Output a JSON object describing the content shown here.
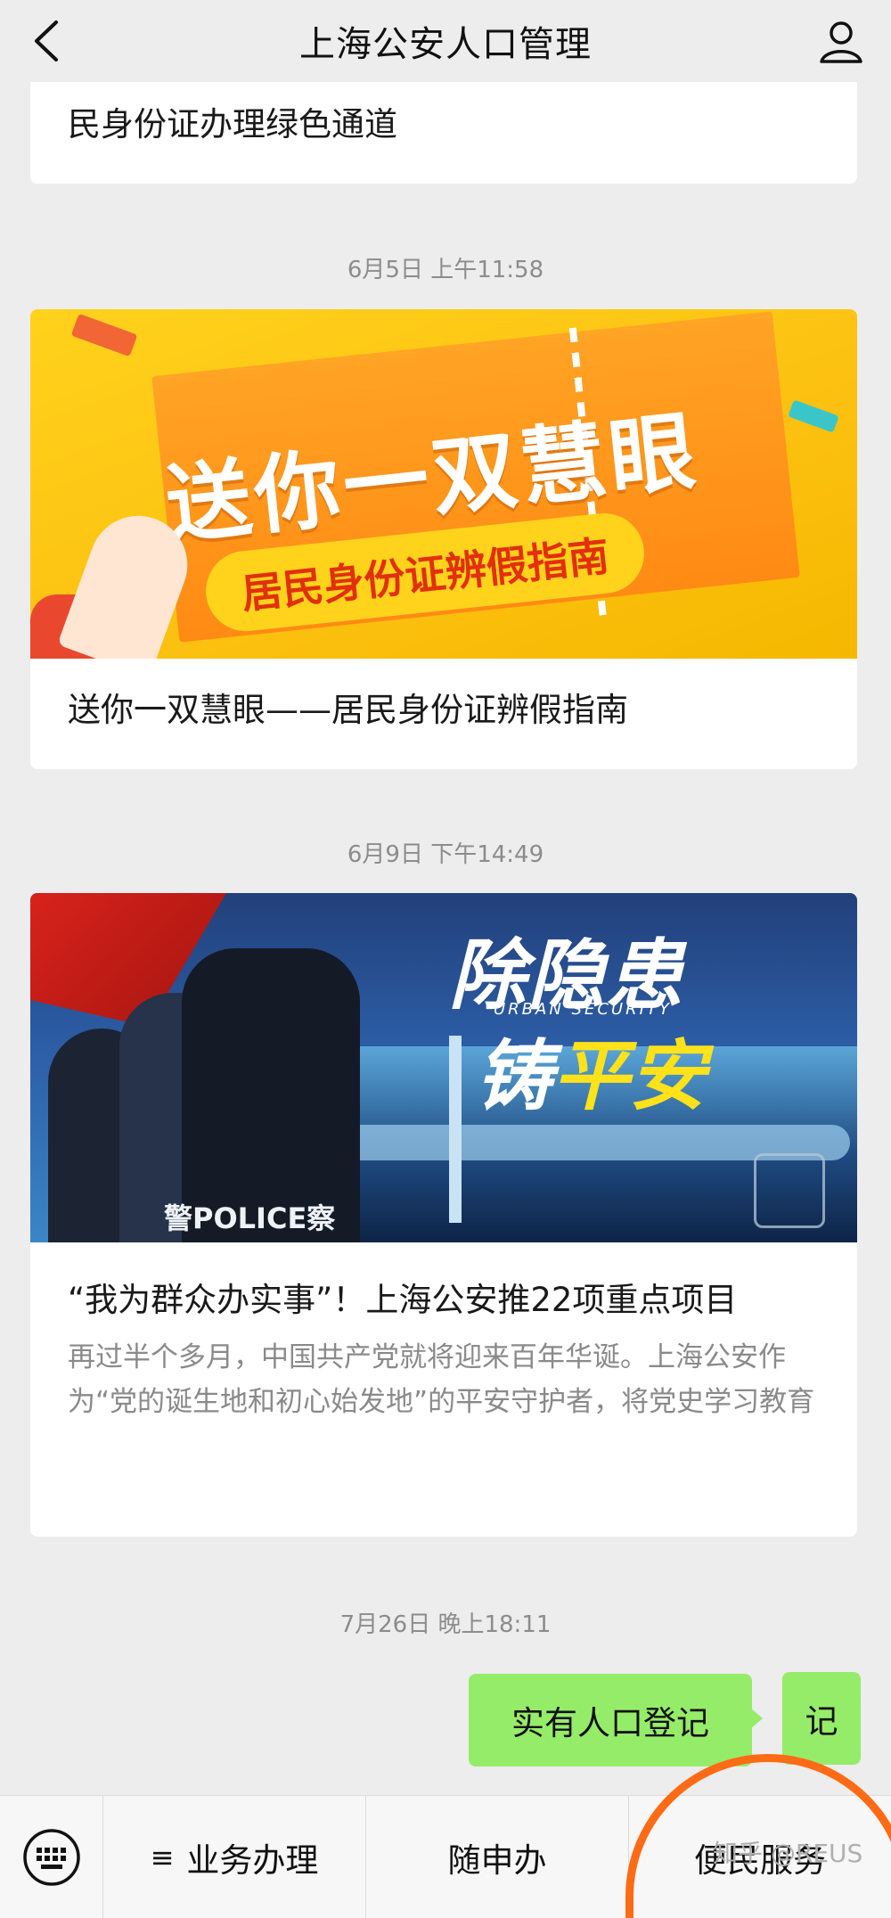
{
  "header": {
    "title": "上海公安人口管理",
    "back_icon": "chevron-left-icon",
    "profile_icon": "person-icon"
  },
  "messages": [
    {
      "title": "民身份证办理绿色通道"
    },
    {
      "timestamp": "6月5日 上午11:58",
      "banner": {
        "headline": "送你一双慧眼",
        "pill": "居民身份证辨假指南"
      },
      "title": "送你一双慧眼——居民身份证辨假指南"
    },
    {
      "timestamp": "6月9日 下午14:49",
      "banner": {
        "headline_top": "除隐患",
        "subtitle": "URBAN SECURITY",
        "headline_bottom_1": "铸",
        "headline_bottom_2": "平安",
        "police_tag": "警POLICE察"
      },
      "title": "“我为群众办实事”！上海公安推22项重点项目",
      "desc": "再过半个多月，中国共产党就将迎来百年华诞。上海公安作为“党的诞生地和初心始发地”的平安守护者，将党史学习教育"
    }
  ],
  "chat": {
    "timestamp": "7月26日 晚上18:11",
    "bubble_text": "实有人口登记",
    "bubble_partial": "记"
  },
  "menu": {
    "keyboard_icon": "keyboard-icon",
    "items": [
      "业务办理",
      "随申办",
      "便民服务"
    ],
    "menu_icon": "≡"
  },
  "watermark": "知乎 @REUS",
  "colors": {
    "bubble": "#95ec69",
    "annotation": "#ff6a15"
  }
}
